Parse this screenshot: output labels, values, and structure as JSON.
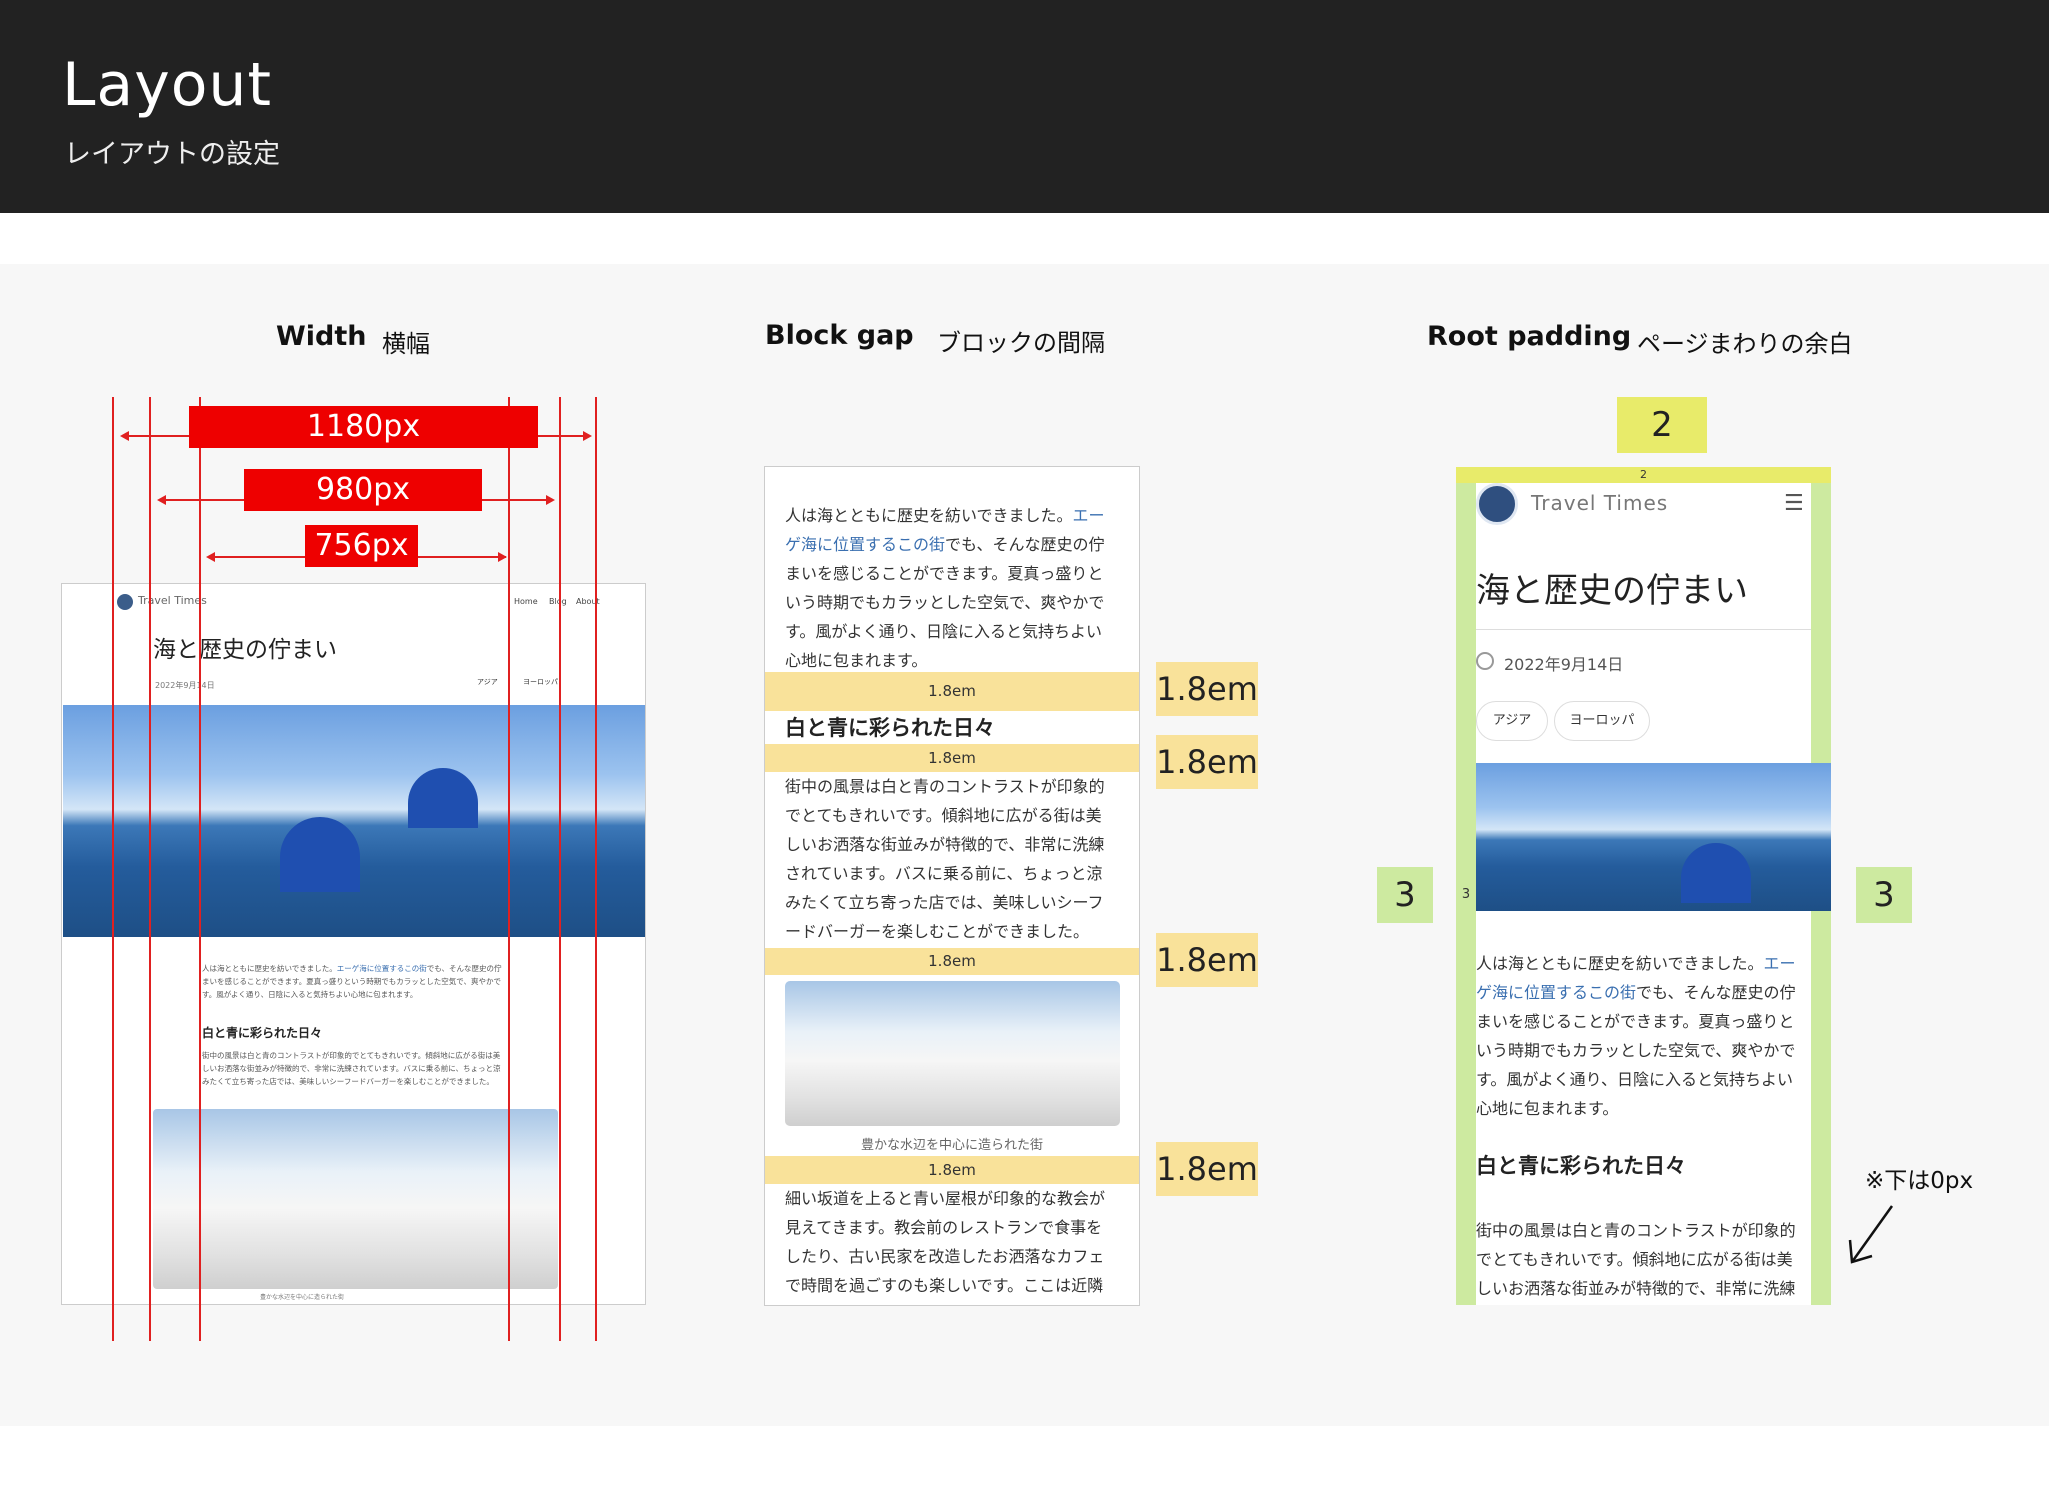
{
  "header": {
    "title": "Layout",
    "subtitle": "レイアウトの設定"
  },
  "sections": {
    "width": {
      "title": "Width",
      "sub": "横幅"
    },
    "blockgap": {
      "title": "Block gap",
      "sub": "ブロックの間隔"
    },
    "rootpadding": {
      "title": "Root padding",
      "sub": "ページまわりの余白"
    }
  },
  "width_labels": {
    "w1": "1180px",
    "w2": "980px",
    "w3": "756px"
  },
  "site": {
    "name": "Travel Times",
    "nav": [
      "Home",
      "Blog",
      "About"
    ],
    "post_title": "海と歴史の佇まい",
    "date": "2022年9月14日",
    "tags": [
      "アジア",
      "ヨーロッパ"
    ],
    "para1_a": "人は海とともに歴史を紡いできました。",
    "para1_link": "エーゲ海に位置するこの街",
    "para1_b": "でも、そんな歴史の佇まいを感じることができます。夏真っ盛りという時期でもカラッとした空気で、爽やかです。風がよく通り、日陰に入ると気持ちよい心地に包まれます。",
    "heading2": "白と青に彩られた日々",
    "para2": "街中の風景は白と青のコントラストが印象的でとてもきれいです。傾斜地に広がる街は美しいお洒落な街並みが特徴的で、非常に洗練されています。バスに乗る前に、ちょっと涼みたくて立ち寄った店では、美味しいシーフードバーガーを楽しむことができました。",
    "caption": "豊かな水辺を中心に造られた街",
    "para3": "細い坂道を上ると青い屋根が印象的な教会が見えてきます。教会前のレストランで食事をしたり、古い民家を改造したお洒落なカフェで時間を過ごすのも楽しいです。ここは近隣"
  },
  "blockgap": {
    "value": "1.8em"
  },
  "rootpadding": {
    "top": "2",
    "side": "3",
    "note": "※下は0px"
  },
  "colors": {
    "header_bg": "#222222",
    "red": "#ee0000",
    "gap": "#f9e29a",
    "pad_top": "#e8eb6a",
    "pad_side": "#cdeaa0",
    "link": "#3a6fb0"
  }
}
